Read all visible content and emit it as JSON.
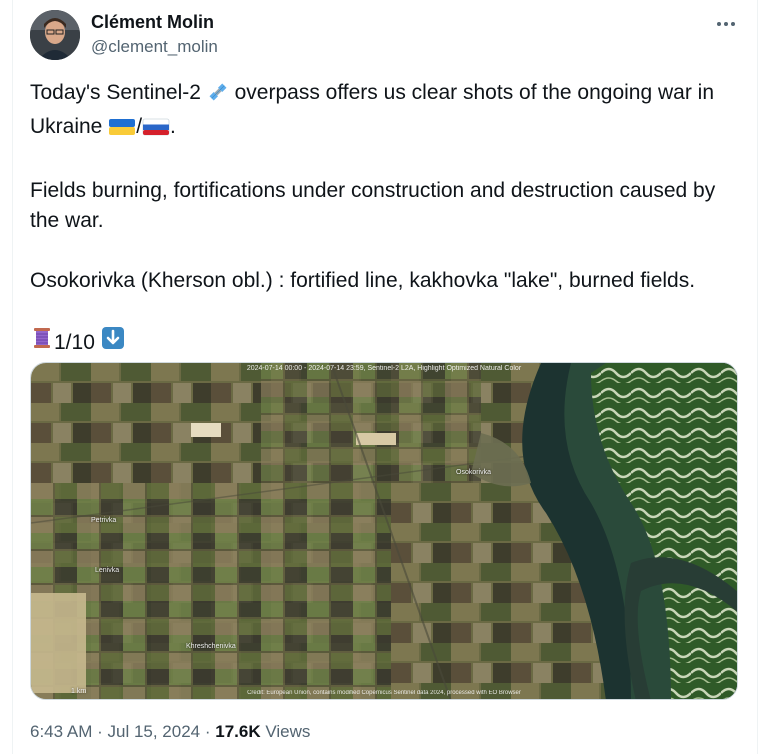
{
  "author": {
    "name": "Clément Molin",
    "handle": "@clement_molin"
  },
  "tweet": {
    "line1_a": "Today's Sentinel-2 ",
    "line1_b": " overpass offers us clear shots of the ongoing war in Ukraine ",
    "flag_sep": "/",
    "line1_end": ".",
    "para2": "Fields burning, fortifications under construction and destruction caused by the war.",
    "para3": "Osokorivka (Kherson obl.) : fortified line, kakhovka \"lake\", burned fields.",
    "thread_count": "1/10"
  },
  "media": {
    "caption_top": "2024-07-14 00:00 - 2024-07-14 23:59, Sentinel-2 L2A, Highlight Optimized Natural Color",
    "caption_bottom": "Credit: European Union, contains modified Copernicus Sentinel data 2024, processed with EO Browser",
    "places": [
      "Osokorivka",
      "Petrivka",
      "Lenivka",
      "Khreshchenivka"
    ],
    "scale": "1 km"
  },
  "footer": {
    "time": "6:43 AM",
    "sep1": " · ",
    "date": "Jul 15, 2024",
    "sep2": " · ",
    "views_count": "17.6K",
    "views_label": " Views"
  },
  "icons": [
    "satellite-icon",
    "ukraine-flag-icon",
    "russia-flag-icon",
    "thread-spool-icon",
    "down-arrow-icon",
    "more-options-icon"
  ],
  "colors": {
    "text": "#0f1419",
    "secondary": "#536471",
    "border": "#eff3f4",
    "arrow_blue": "#3b88c3"
  }
}
